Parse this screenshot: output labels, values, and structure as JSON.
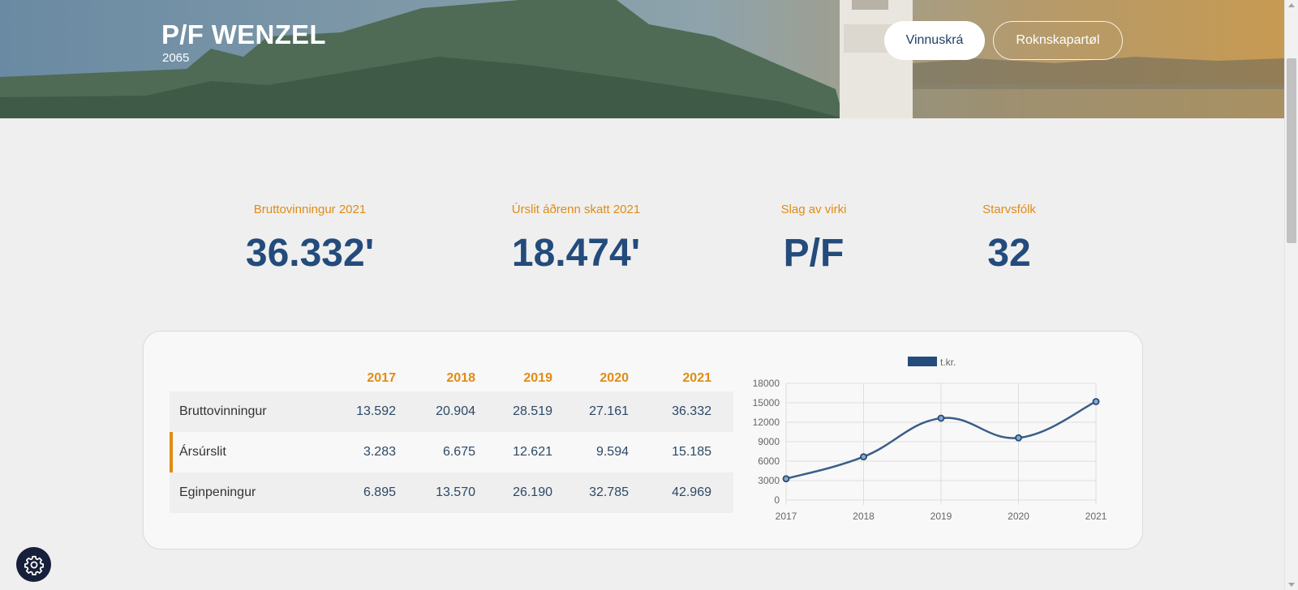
{
  "hero": {
    "title": "P/F WENZEL",
    "subtitle": "2065",
    "buttons": {
      "primary": "Vinnuskrá",
      "secondary": "Roknskapartøl"
    }
  },
  "kpis": [
    {
      "label": "Bruttovinningur 2021",
      "value": "36.332'"
    },
    {
      "label": "Úrslit áðrenn skatt 2021",
      "value": "18.474'"
    },
    {
      "label": "Slag av virki",
      "value": "P/F"
    },
    {
      "label": "Starvsfólk",
      "value": "32"
    }
  ],
  "table": {
    "years": [
      "2017",
      "2018",
      "2019",
      "2020",
      "2021"
    ],
    "rows": [
      {
        "label": "Bruttovinningur",
        "values": [
          "13.592",
          "20.904",
          "28.519",
          "27.161",
          "36.332"
        ]
      },
      {
        "label": "Ársúrslit",
        "values": [
          "3.283",
          "6.675",
          "12.621",
          "9.594",
          "15.185"
        ]
      },
      {
        "label": "Eginpeningur",
        "values": [
          "6.895",
          "13.570",
          "26.190",
          "32.785",
          "42.969"
        ]
      }
    ]
  },
  "chart_data": {
    "type": "line",
    "x": [
      "2017",
      "2018",
      "2019",
      "2020",
      "2021"
    ],
    "series": [
      {
        "name": "t.kr.",
        "values": [
          3283,
          6675,
          12621,
          9594,
          15185
        ]
      }
    ],
    "yticks": [
      "18000",
      "15000",
      "12000",
      "9000",
      "6000",
      "3000",
      "0"
    ],
    "ylim": [
      0,
      18000
    ],
    "grid": true,
    "legend": "top",
    "color": "#3b5d88"
  },
  "colors": {
    "accent": "#e08c14",
    "primary": "#234b7b"
  },
  "icons": {
    "settings": "gear-icon"
  }
}
